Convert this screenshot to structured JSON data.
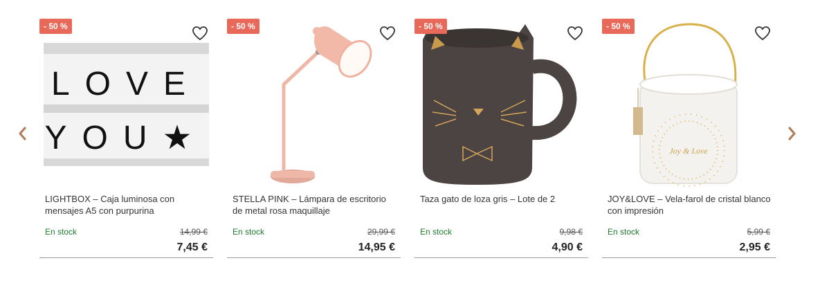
{
  "colors": {
    "badge": "#e8695a",
    "stock": "#1e7a2e",
    "arrow": "#b07a55"
  },
  "carousel": {
    "prev_icon": "chevron-left-icon",
    "next_icon": "chevron-right-icon",
    "products": [
      {
        "badge": "- 50 %",
        "title": "LIGHTBOX – Caja luminosa con mensajes A5 con purpurina",
        "stock": "En stock",
        "old_price": "14,99 €",
        "price": "7,45 €",
        "image_icon": "lightbox-image",
        "lightbox_line1": "LOVE",
        "lightbox_line2": "YOU★"
      },
      {
        "badge": "- 50 %",
        "title": "STELLA PINK – Lámpara de escritorio de metal rosa maquillaje",
        "stock": "En stock",
        "old_price": "29,99 €",
        "price": "14,95 €",
        "image_icon": "desk-lamp-image"
      },
      {
        "badge": "- 50 %",
        "title": "Taza gato de loza gris – Lote de 2",
        "stock": "En stock",
        "old_price": "9,98 €",
        "price": "4,90 €",
        "image_icon": "cat-mug-image"
      },
      {
        "badge": "- 50 %",
        "title": "JOY&LOVE – Vela-farol de cristal blanco con impresión",
        "stock": "En stock",
        "old_price": "5,99 €",
        "price": "2,95 €",
        "image_icon": "candle-lantern-image",
        "candle_text": "Joy & Love"
      }
    ]
  }
}
